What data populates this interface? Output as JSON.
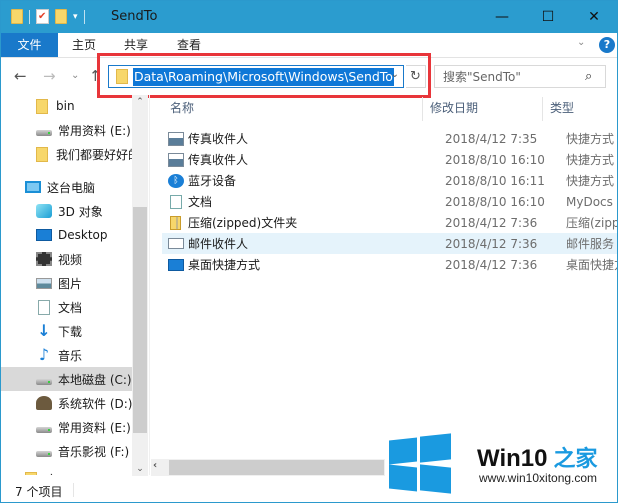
{
  "window": {
    "title": "SendTo",
    "controls": {
      "minimize": "—",
      "maximize": "☐",
      "close": "✕"
    }
  },
  "ribbon": {
    "tabs": [
      {
        "label": "文件",
        "active": true
      },
      {
        "label": "主页"
      },
      {
        "label": "共享"
      },
      {
        "label": "查看"
      }
    ],
    "expand_icon": "⌄",
    "help_icon": "?"
  },
  "nav": {
    "back": "←",
    "forward": "→",
    "recent": "⌄",
    "up": "↑",
    "address": "Data\\Roaming\\Microsoft\\Windows\\SendTo",
    "address_dropdown": "⌄",
    "refresh": "↻",
    "search_placeholder": "搜索\"SendTo\"",
    "search_icon": "⌕"
  },
  "sidebar": {
    "items": [
      {
        "label": "bin",
        "icon": "folder"
      },
      {
        "label": "常用资料 (E:)",
        "icon": "drive"
      },
      {
        "label": "我们都要好好的",
        "icon": "folder"
      },
      {
        "label": "这台电脑",
        "icon": "pc"
      },
      {
        "label": "3D 对象",
        "icon": "3d-objects"
      },
      {
        "label": "Desktop",
        "icon": "desktop"
      },
      {
        "label": "视频",
        "icon": "video"
      },
      {
        "label": "图片",
        "icon": "pictures"
      },
      {
        "label": "文档",
        "icon": "documents"
      },
      {
        "label": "下载",
        "icon": "downloads"
      },
      {
        "label": "音乐",
        "icon": "music"
      },
      {
        "label": "本地磁盘 (C:)",
        "icon": "drive",
        "selected": true
      },
      {
        "label": "系统软件 (D:)",
        "icon": "drive-custom"
      },
      {
        "label": "常用资料 (E:)",
        "icon": "drive"
      },
      {
        "label": "音乐影视 (F:)",
        "icon": "drive"
      },
      {
        "label": "库",
        "icon": "folder"
      }
    ],
    "scroll_up": "⌃",
    "scroll_down": "⌄"
  },
  "columns": {
    "name": "名称",
    "date": "修改日期",
    "type": "类型"
  },
  "files": [
    {
      "name": "传真收件人",
      "date": "2018/4/12 7:35",
      "type": "快捷方式",
      "icon": "fax"
    },
    {
      "name": "传真收件人",
      "date": "2018/8/10 16:10",
      "type": "快捷方式",
      "icon": "fax"
    },
    {
      "name": "蓝牙设备",
      "date": "2018/8/10 16:11",
      "type": "快捷方式",
      "icon": "bluetooth"
    },
    {
      "name": "文档",
      "date": "2018/8/10 16:10",
      "type": "MyDocs 下载",
      "icon": "document"
    },
    {
      "name": "压缩(zipped)文件夹",
      "date": "2018/4/12 7:36",
      "type": "压缩(zipped)",
      "icon": "zip"
    },
    {
      "name": "邮件收件人",
      "date": "2018/4/12 7:36",
      "type": "邮件服务",
      "icon": "mail",
      "highlighted": true
    },
    {
      "name": "桌面快捷方式",
      "date": "2018/4/12 7:36",
      "type": "桌面快捷方式",
      "icon": "desktop"
    }
  ],
  "hscroll": {
    "left": "‹"
  },
  "status": {
    "count": "7 个项目"
  },
  "watermark": {
    "title": "Win10",
    "title_cn": "之家",
    "url": "www.win10xitong.com"
  },
  "colors": {
    "titlebar": "#2b9ccf",
    "accent": "#1979ca",
    "selection": "#0f78d7",
    "highlight_row": "#e5f3fb",
    "annotation_box": "#e8353a"
  }
}
